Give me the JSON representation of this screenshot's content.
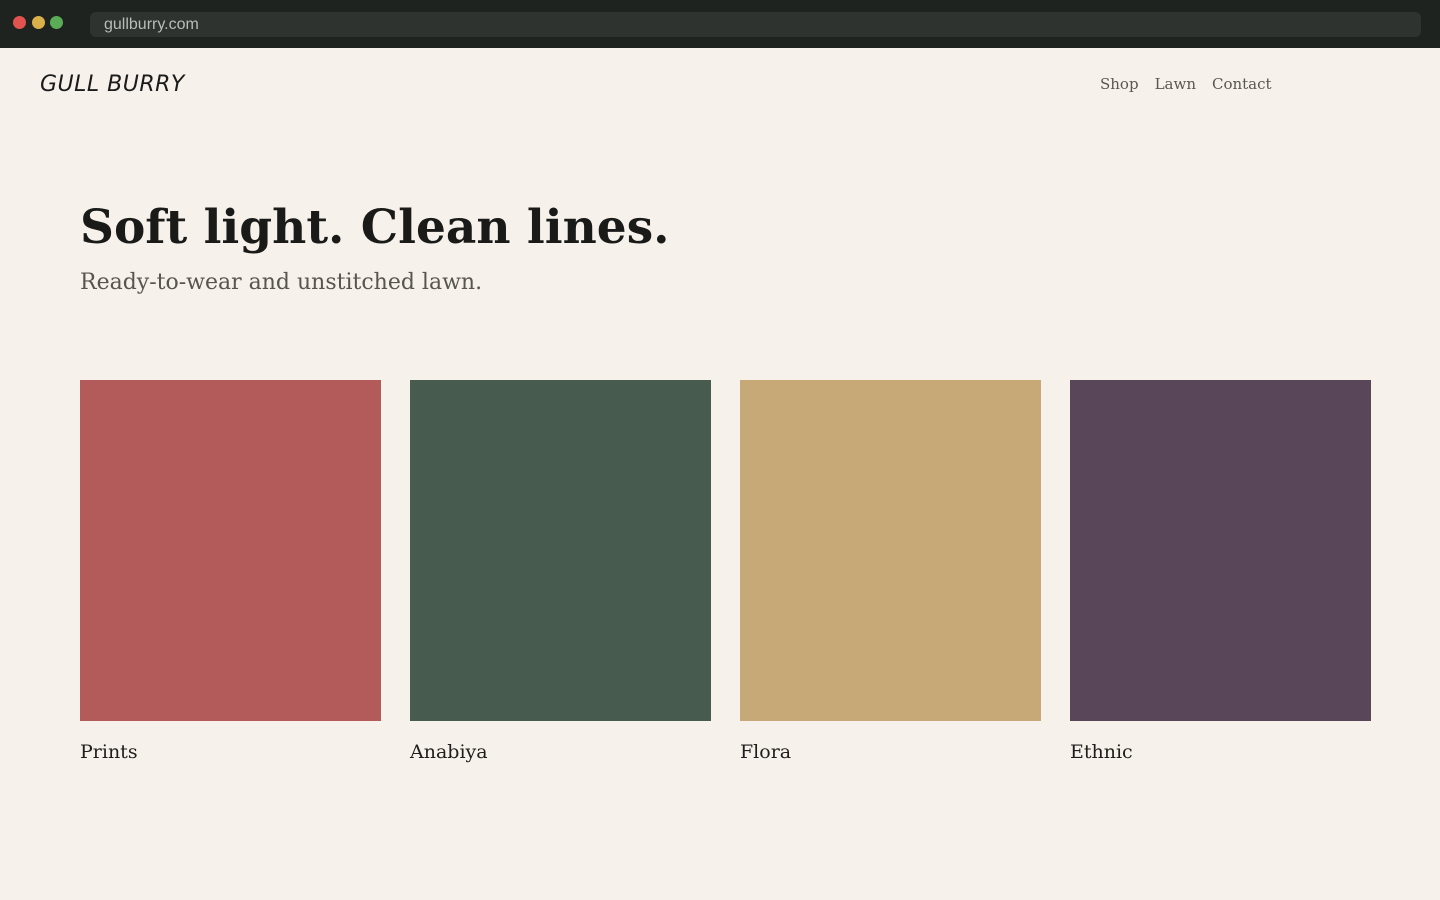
{
  "browser": {
    "url": "gullburry.com"
  },
  "header": {
    "logo": "GULL BURRY",
    "nav": [
      {
        "label": "Shop"
      },
      {
        "label": "Lawn"
      },
      {
        "label": "Contact"
      }
    ]
  },
  "hero": {
    "title": "Soft light. Clean lines.",
    "subtitle": "Ready-to-wear and unstitched lawn."
  },
  "collections": [
    {
      "label": "Prints",
      "color": "#b35b5b"
    },
    {
      "label": "Anabiya",
      "color": "#475b4f"
    },
    {
      "label": "Flora",
      "color": "#c7a977"
    },
    {
      "label": "Ethnic",
      "color": "#5a4659"
    }
  ]
}
